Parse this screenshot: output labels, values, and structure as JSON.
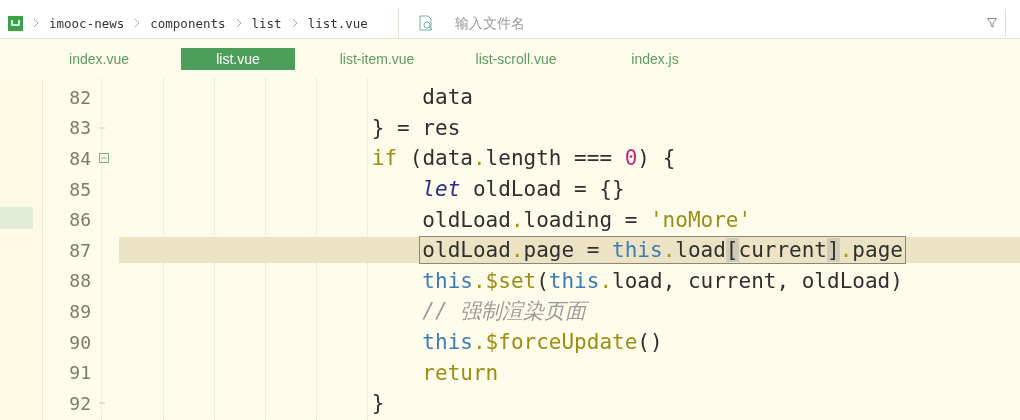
{
  "breadcrumb": [
    "imooc-news",
    "components",
    "list",
    "list.vue"
  ],
  "search": {
    "placeholder": "输入文件名"
  },
  "tabs": [
    {
      "label": "index.vue",
      "selected": false
    },
    {
      "label": "list.vue",
      "selected": true
    },
    {
      "label": "list-item.vue",
      "selected": false
    },
    {
      "label": "list-scroll.vue",
      "selected": false
    },
    {
      "label": "index.js",
      "selected": false
    }
  ],
  "code": [
    {
      "children": [
        {
          "number": "82",
          "kind": "plain",
          "tokens": [
            {
              "kind": "plain",
              "text": "data"
            }
          ]
        }
      ]
    },
    {
      "number": "83",
      "kind": "closer",
      "tokens": [
        {
          "kind": "plain",
          "text": "} = res"
        }
      ]
    },
    {
      "number": "84",
      "kind": "opener",
      "tokens": [
        {
          "kind": "keyword",
          "text": "if"
        },
        {
          "kind": "plain",
          "text": " (data"
        },
        {
          "kind": "dot",
          "text": "."
        },
        {
          "kind": "plain",
          "text": "length === "
        },
        {
          "kind": "number",
          "text": "0"
        },
        {
          "kind": "plain",
          "text": ") {"
        }
      ],
      "children": [
        {
          "number": "85",
          "kind": "plain",
          "tokens": [
            {
              "kind": "declare",
              "text": "let"
            },
            {
              "kind": "plain",
              "text": " oldLoad = {}"
            }
          ]
        },
        {
          "number": "86",
          "kind": "plain",
          "tokens": [
            {
              "kind": "plain",
              "text": "oldLoad"
            },
            {
              "kind": "dot",
              "text": "."
            },
            {
              "kind": "plain",
              "text": "loading = "
            },
            {
              "kind": "string",
              "text": "'noMore'"
            }
          ]
        },
        {
          "number": "87",
          "kind": "plain",
          "current": true,
          "boxed": true,
          "tokens": [
            {
              "kind": "plain",
              "text": "oldLoad"
            },
            {
              "kind": "dot",
              "text": "."
            },
            {
              "kind": "plain",
              "text": "page = "
            },
            {
              "kind": "this",
              "text": "this"
            },
            {
              "kind": "dot",
              "text": "."
            },
            {
              "kind": "plain",
              "text": "load"
            },
            {
              "kind": "bracket",
              "text": "["
            },
            {
              "kind": "plain",
              "text": "current"
            },
            {
              "kind": "bracket",
              "text": "]"
            },
            {
              "kind": "dot",
              "text": "."
            },
            {
              "kind": "plain",
              "text": "page"
            }
          ]
        },
        {
          "number": "88",
          "kind": "plain",
          "tokens": [
            {
              "kind": "this",
              "text": "this"
            },
            {
              "kind": "dot",
              "text": "."
            },
            {
              "kind": "method",
              "text": "$set"
            },
            {
              "kind": "plain",
              "text": "("
            },
            {
              "kind": "this",
              "text": "this"
            },
            {
              "kind": "dot",
              "text": "."
            },
            {
              "kind": "plain",
              "text": "load, current, oldLoad)"
            }
          ]
        },
        {
          "number": "89",
          "kind": "plain",
          "tokens": [
            {
              "kind": "comment",
              "text": "// 强制渲染页面"
            }
          ]
        },
        {
          "number": "90",
          "kind": "plain",
          "tokens": [
            {
              "kind": "this",
              "text": "this"
            },
            {
              "kind": "dot",
              "text": "."
            },
            {
              "kind": "method",
              "text": "$forceUpdate"
            },
            {
              "kind": "plain",
              "text": "()"
            }
          ]
        },
        {
          "number": "91",
          "kind": "plain",
          "tokens": [
            {
              "kind": "keyword",
              "text": "return"
            }
          ]
        }
      ]
    },
    {
      "number": "92",
      "kind": "closer",
      "tokens": [
        {
          "kind": "plain",
          "text": "}"
        }
      ]
    }
  ]
}
